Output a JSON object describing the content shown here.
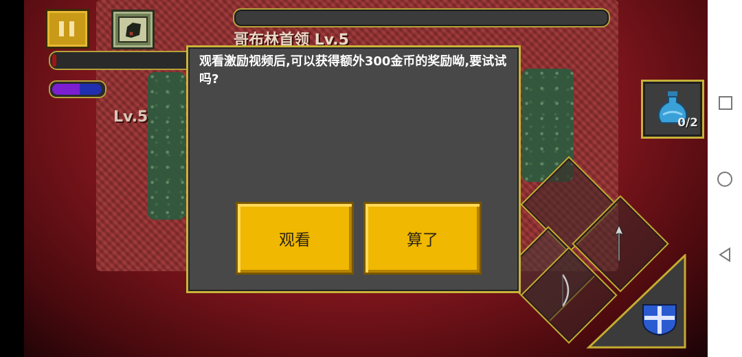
{
  "hud": {
    "boss_name": "哥布林首领 Lv.5",
    "player_level": "Lv.5",
    "potion_count": "0/2"
  },
  "dialog": {
    "message": "观看激励视频后,可以获得额外300金币的奖励呦,要试试吗?",
    "watch_label": "观看",
    "cancel_label": "算了"
  },
  "icons": {
    "pause": "pause-icon",
    "map": "map-scroll-icon",
    "potion": "potion-icon",
    "arrow": "arrow-icon",
    "bow": "bow-icon",
    "shield": "shield-icon"
  },
  "colors": {
    "accent_gold": "#f0b800",
    "border_gold": "#c9b43a",
    "dialog_bg": "#484848",
    "scene_red": "#8a1820"
  }
}
